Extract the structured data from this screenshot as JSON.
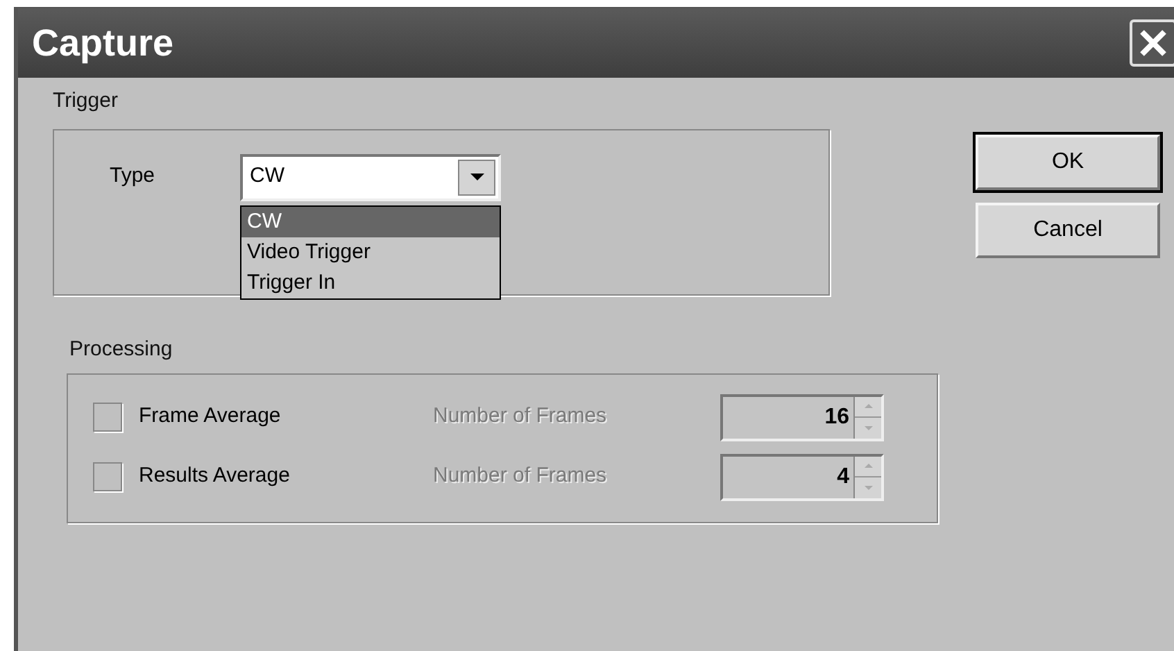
{
  "window": {
    "title": "Capture"
  },
  "trigger": {
    "label": "Trigger",
    "type_label": "Type",
    "value": "CW",
    "options": [
      {
        "label": "CW",
        "selected": true
      },
      {
        "label": "Video Trigger",
        "selected": false
      },
      {
        "label": "Trigger In",
        "selected": false
      }
    ]
  },
  "processing": {
    "label": "Processing",
    "rows": [
      {
        "label": "Frame Average",
        "checked": false,
        "frames_label": "Number of Frames",
        "frames_disabled": true,
        "value": "16"
      },
      {
        "label": "Results Average",
        "checked": false,
        "frames_label": "Number of Frames",
        "frames_disabled": true,
        "value": "4"
      }
    ]
  },
  "buttons": [
    {
      "label": "OK",
      "default": true
    },
    {
      "label": "Cancel",
      "default": false
    }
  ]
}
